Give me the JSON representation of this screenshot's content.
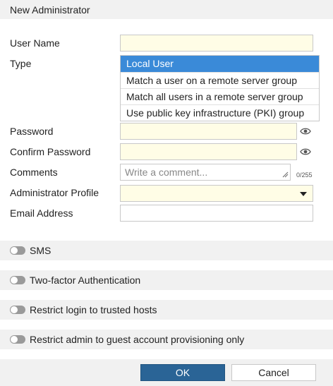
{
  "dialog": {
    "title": "New Administrator"
  },
  "form": {
    "user_name": {
      "label": "User Name",
      "value": ""
    },
    "type": {
      "label": "Type",
      "options": [
        "Local User",
        "Match a user on a remote server group",
        "Match all users in a remote server group",
        "Use public key infrastructure (PKI) group"
      ],
      "selected": "Local User"
    },
    "password": {
      "label": "Password",
      "value": ""
    },
    "confirm_password": {
      "label": "Confirm Password",
      "value": ""
    },
    "comments": {
      "label": "Comments",
      "placeholder": "Write a comment...",
      "counter": "0/255"
    },
    "admin_profile": {
      "label": "Administrator Profile",
      "value": ""
    },
    "email": {
      "label": "Email Address",
      "value": ""
    }
  },
  "toggles": [
    {
      "label": "SMS",
      "enabled": false
    },
    {
      "label": "Two-factor Authentication",
      "enabled": false
    },
    {
      "label": "Restrict login to trusted hosts",
      "enabled": false
    },
    {
      "label": "Restrict admin to guest account provisioning only",
      "enabled": false
    }
  ],
  "footer": {
    "ok_label": "OK",
    "cancel_label": "Cancel"
  },
  "colors": {
    "selected_option": "#3a8ad8",
    "input_background": "#fffde6",
    "ok_button": "#2a6496",
    "section_background": "#f1f1f1"
  }
}
